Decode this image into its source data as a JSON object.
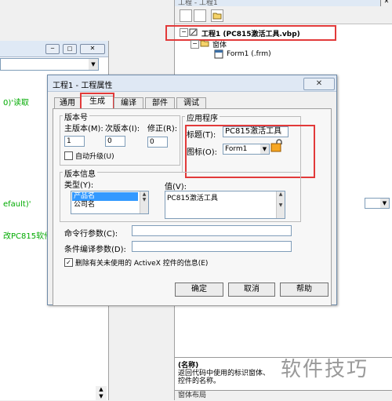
{
  "project_pane": {
    "title": "工程 - 工程1",
    "tree": {
      "project": "工程1 (PC815激活工具.vbp)",
      "forms_folder": "窗体",
      "form_item": "Form1 (.frm)"
    },
    "description_title": "(名称)",
    "description_text": "返回代码中使用的标识窗体、控件的名称。",
    "bottom_label": "窗体布局"
  },
  "code_window": {
    "lines": [
      "0)'读取",
      "efault)'",
      "改PC815软件"
    ]
  },
  "dialog": {
    "title": "工程1 - 工程属性",
    "close_label": "✕",
    "tabs": [
      {
        "label": "通用"
      },
      {
        "label": "生成"
      },
      {
        "label": "编译"
      },
      {
        "label": "部件"
      },
      {
        "label": "调试"
      }
    ],
    "version_group": {
      "label": "版本号",
      "major_label": "主版本(M):",
      "minor_label": "次版本(I):",
      "revision_label": "修正(R):",
      "major_value": "1",
      "minor_value": "0",
      "revision_value": "0",
      "auto_increment_label": "自动升级(U)"
    },
    "app_group": {
      "label": "应用程序",
      "title_label": "标题(T):",
      "title_value": "PC815激活工具",
      "icon_label": "图标(O):",
      "icon_value": "Form1"
    },
    "version_info": {
      "label": "版本信息",
      "type_label": "类型(Y):",
      "value_label": "值(V):",
      "types": [
        "产品名",
        "公司名"
      ],
      "value_text": "PC815激活工具"
    },
    "cmd_args_label": "命令行参数(C):",
    "cond_compile_label": "条件编译参数(D):",
    "remove_info_label": "删除有关未使用的 ActiveX 控件的信息(E)",
    "buttons": {
      "ok": "确定",
      "cancel": "取消",
      "help": "帮助"
    }
  },
  "watermark": "软件技巧",
  "colors": {
    "highlight_red": "#e23a3a",
    "selection_blue": "#3399ff",
    "code_green": "#00aa00"
  }
}
